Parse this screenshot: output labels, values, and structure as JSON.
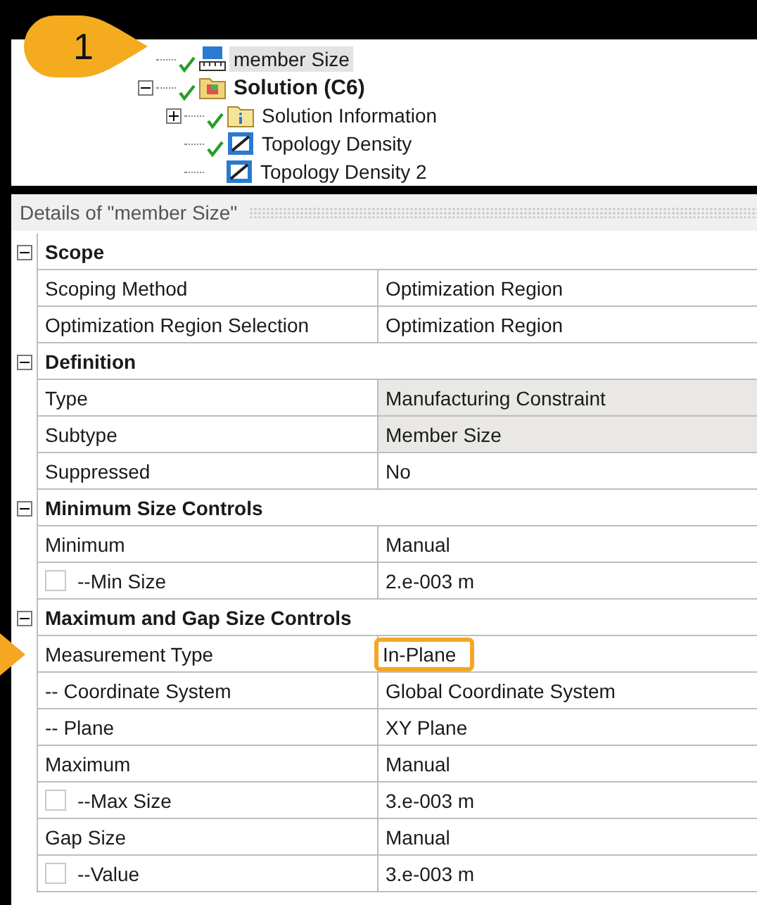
{
  "callout": {
    "label": "1"
  },
  "tree": [
    {
      "label": "member Size",
      "selected": true,
      "bold": false,
      "ok": true,
      "kind": "constraint"
    },
    {
      "label": "Solution (C6)",
      "selected": false,
      "bold": true,
      "ok": true,
      "kind": "solution",
      "expanded": true,
      "children": [
        {
          "label": "Solution Information",
          "selected": false,
          "bold": false,
          "ok": true,
          "kind": "information",
          "expanded": false
        },
        {
          "label": "Topology Density",
          "selected": false,
          "bold": false,
          "ok": true,
          "kind": "result"
        },
        {
          "label": "Topology Density 2",
          "selected": false,
          "bold": false,
          "ok": false,
          "kind": "result"
        }
      ]
    }
  ],
  "details": {
    "title": "Details of \"member Size\"",
    "groups": [
      {
        "title": "Scope",
        "expanded": true,
        "rows": [
          {
            "label": "Scoping Method",
            "value": "Optimization Region",
            "kind": "plain",
            "readonly": false,
            "highlighted": false,
            "pointer": false
          },
          {
            "label": "Optimization Region Selection",
            "value": "Optimization Region",
            "kind": "plain",
            "readonly": false,
            "highlighted": false,
            "pointer": false
          }
        ]
      },
      {
        "title": "Definition",
        "expanded": true,
        "rows": [
          {
            "label": "Type",
            "value": "Manufacturing Constraint",
            "kind": "plain",
            "readonly": true,
            "highlighted": false,
            "pointer": false
          },
          {
            "label": "Subtype",
            "value": "Member Size",
            "kind": "plain",
            "readonly": true,
            "highlighted": false,
            "pointer": false
          },
          {
            "label": "Suppressed",
            "value": "No",
            "kind": "plain",
            "readonly": false,
            "highlighted": false,
            "pointer": false
          }
        ]
      },
      {
        "title": "Minimum Size Controls",
        "expanded": true,
        "rows": [
          {
            "label": "Minimum",
            "value": "Manual",
            "kind": "plain",
            "readonly": false,
            "highlighted": false,
            "pointer": false
          },
          {
            "label": "--Min Size",
            "value": "2.e-003 m",
            "kind": "checkbox",
            "checked": false,
            "readonly": false,
            "highlighted": false,
            "pointer": false
          }
        ]
      },
      {
        "title": "Maximum and Gap Size Controls",
        "expanded": true,
        "rows": [
          {
            "label": "Measurement Type",
            "value": "In-Plane",
            "kind": "plain",
            "readonly": false,
            "highlighted": true,
            "pointer": true
          },
          {
            "label": "-- Coordinate System",
            "value": "Global Coordinate System",
            "kind": "plain",
            "readonly": false,
            "highlighted": false,
            "pointer": false
          },
          {
            "label": "-- Plane",
            "value": "XY Plane",
            "kind": "plain",
            "readonly": false,
            "highlighted": false,
            "pointer": false
          },
          {
            "label": "Maximum",
            "value": "Manual",
            "kind": "plain",
            "readonly": false,
            "highlighted": false,
            "pointer": false
          },
          {
            "label": "--Max Size",
            "value": "3.e-003 m",
            "kind": "checkbox",
            "checked": false,
            "readonly": false,
            "highlighted": false,
            "pointer": false
          },
          {
            "label": "Gap Size",
            "value": "Manual",
            "kind": "plain",
            "readonly": false,
            "highlighted": false,
            "pointer": false
          },
          {
            "label": "--Value",
            "value": "3.e-003 m",
            "kind": "checkbox",
            "checked": false,
            "readonly": false,
            "highlighted": false,
            "pointer": false
          }
        ]
      }
    ]
  }
}
